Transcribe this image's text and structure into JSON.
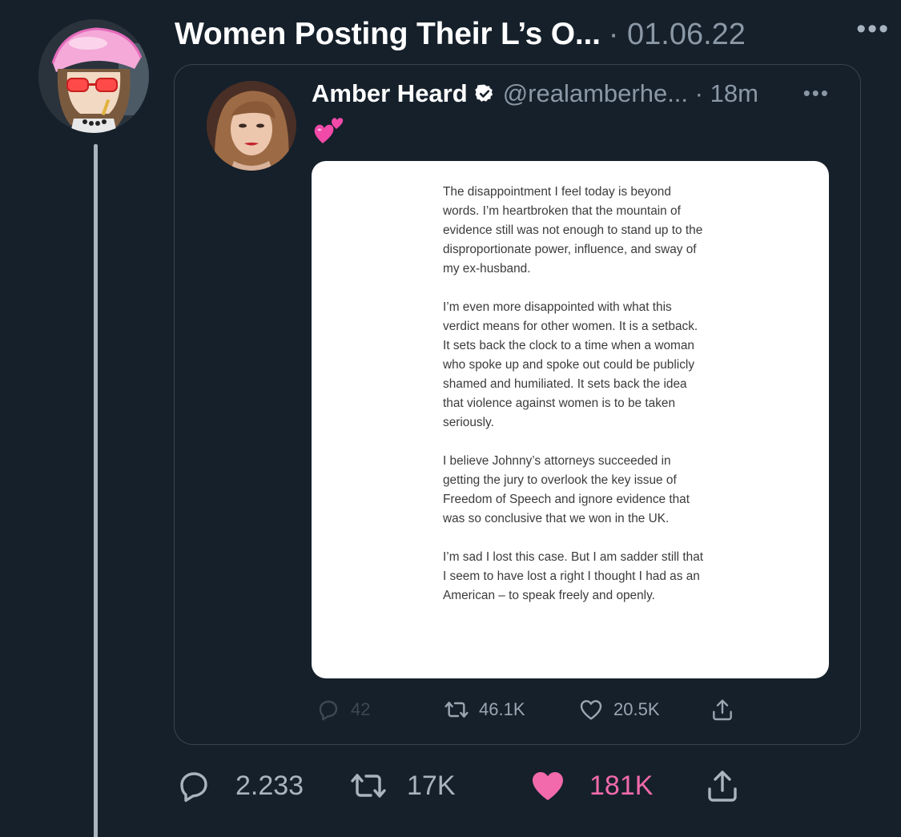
{
  "header": {
    "author_name": "Women Posting Their L’s O...",
    "separator_date": "· 01.06.22",
    "more": "•••"
  },
  "quote": {
    "name": "Amber Heard",
    "handle_time": "@realamberhe... · 18m",
    "more": "•••",
    "emoji": "two-hearts-emoji",
    "statement": [
      "The disappointment I feel today is beyond words. I’m heartbroken that the mountain of evidence still was not enough to stand up to the disproportionate power, influence, and sway of my ex-husband.",
      "I’m even more disappointed with what this verdict means for other women. It is a setback. It sets back the clock to a time when a woman who spoke up and spoke out could be publicly shamed and humiliated. It sets back the idea that violence against women is to be taken seriously.",
      "I believe Johnny’s attorneys succeeded in getting the jury to overlook the key issue of Freedom of Speech and ignore evidence that was so conclusive that we won in the UK.",
      "I’m sad I lost this case. But I am sadder still that I seem to have lost a right I thought I had as an American – to speak freely and openly."
    ],
    "actions": {
      "replies": "42",
      "retweets": "46.1K",
      "likes": "20.5K"
    }
  },
  "actions": {
    "replies": "2.233",
    "retweets": "17K",
    "likes": "181K"
  },
  "colors": {
    "background": "#15202b",
    "like_pink": "#f26aab",
    "muted": "#8b98a5",
    "verified_bg": "#ffffff"
  }
}
